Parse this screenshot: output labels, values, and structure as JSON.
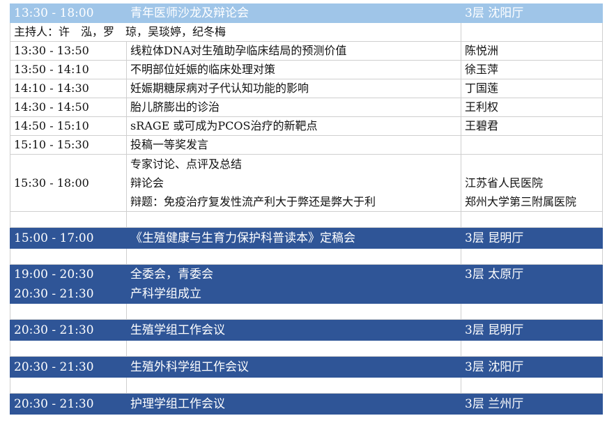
{
  "sections": {
    "salon": {
      "time": "13:30 - 18:00",
      "title": "青年医师沙龙及辩论会",
      "room": "3层 沈阳厅",
      "moderators": "主持人：许　泓，罗　琼，吴琰婷，纪冬梅",
      "talks": [
        {
          "time": "13:30 - 13:50",
          "topic": "线粒体DNA对生殖助孕临床结局的预测价值",
          "speaker": "陈悦洲"
        },
        {
          "time": "13:50 - 14:10",
          "topic": "不明部位妊娠的临床处理对策",
          "speaker": "徐玉萍"
        },
        {
          "time": "14:10 - 14:30",
          "topic": "妊娠期糖尿病对子代认知功能的影响",
          "speaker": "丁国莲"
        },
        {
          "time": "14:30 - 14:50",
          "topic": "胎儿脐膨出的诊治",
          "speaker": "王利权"
        },
        {
          "time": "14:50 - 15:10",
          "topic": "sRAGE 或可成为PCOS治疗的新靶点",
          "speaker": "王碧君"
        },
        {
          "time": "15:10 - 15:30",
          "topic": "投稿一等奖发言",
          "speaker": ""
        }
      ],
      "final": {
        "time": "15:30 - 18:00",
        "line1": "专家讨论、点评及总结",
        "line2": "辩论会",
        "line3": "辩题：免疫治疗复发性流产利大于弊还是弊大于利",
        "aff1": "",
        "aff2": "江苏省人民医院",
        "aff3": "郑州大学第三附属医院"
      }
    },
    "book": {
      "time": "15:00 - 17:00",
      "title": "《生殖健康与生育力保护科普读本》定稿会",
      "room": "3层 昆明厅"
    },
    "committee": {
      "time1": "19:00 - 20:30",
      "title1": "全委会，青委会",
      "room": "3层 太原厅",
      "time2": "20:30 - 21:30",
      "title2": "产科学组成立"
    },
    "repro_group": {
      "time": "20:30 - 21:30",
      "title": "生殖学组工作会议",
      "room": "3层 昆明厅"
    },
    "surgery_group": {
      "time": "20:30 - 21:30",
      "title": "生殖外科学组工作会议",
      "room": "3层 沈阳厅"
    },
    "nursing_group": {
      "time": "20:30 - 21:30",
      "title": "护理学组工作会议",
      "room": "3层 兰州厅"
    }
  },
  "colors": {
    "header_light": "#9fc5e8",
    "header_dark": "#2f5597",
    "grid": "#cfcfcf"
  }
}
